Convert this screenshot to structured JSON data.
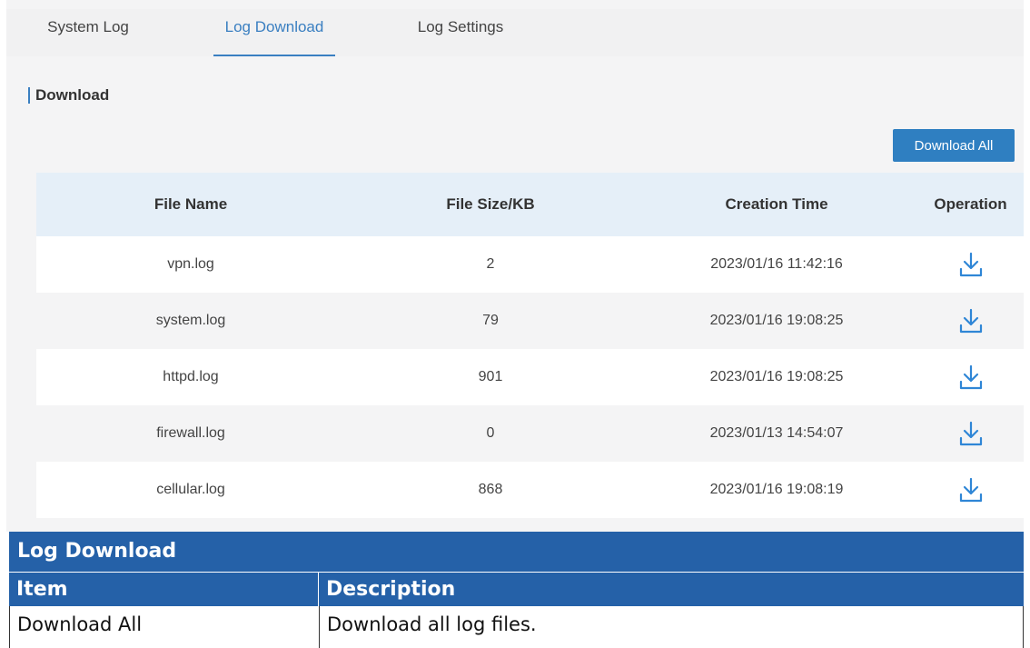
{
  "tabs": [
    {
      "label": "System Log",
      "active": false
    },
    {
      "label": "Log Download",
      "active": true
    },
    {
      "label": "Log Settings",
      "active": false
    }
  ],
  "section_title": "Download",
  "download_all_label": "Download All",
  "table": {
    "headers": [
      "File Name",
      "File Size/KB",
      "Creation Time",
      "Operation"
    ],
    "rows": [
      {
        "name": "vpn.log",
        "size": "2",
        "time": "2023/01/16 11:42:16"
      },
      {
        "name": "system.log",
        "size": "79",
        "time": "2023/01/16 19:08:25"
      },
      {
        "name": "httpd.log",
        "size": "901",
        "time": "2023/01/16 19:08:25"
      },
      {
        "name": "firewall.log",
        "size": "0",
        "time": "2023/01/13 14:54:07"
      },
      {
        "name": "cellular.log",
        "size": "868",
        "time": "2023/01/16 19:08:19"
      }
    ],
    "operation_icon": "download-icon"
  },
  "doc": {
    "title": "Log Download",
    "col_item": "Item",
    "col_description": "Description",
    "rows": [
      {
        "item": "Download All",
        "description": "Download all log files."
      }
    ]
  },
  "colors": {
    "accent": "#3a7fc1",
    "button": "#2f7fc1",
    "table_header_bg": "#e5eff8",
    "doc_header_bg": "#2561a8"
  }
}
